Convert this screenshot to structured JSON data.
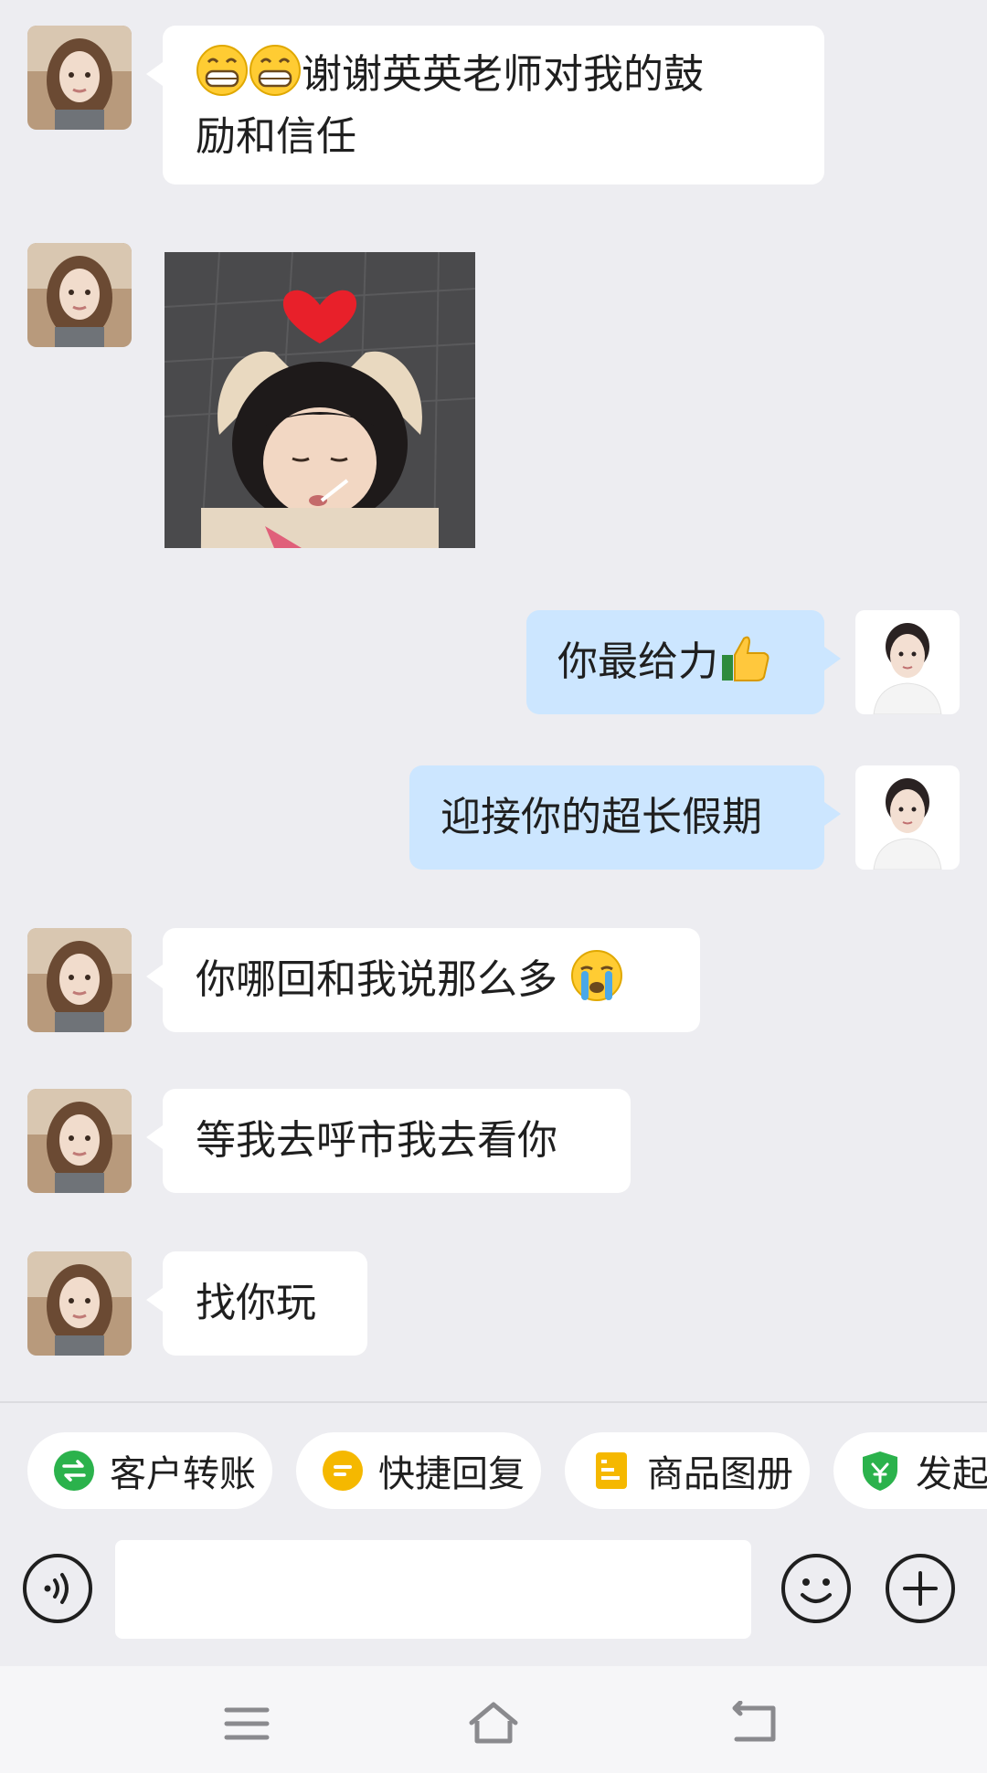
{
  "messages": [
    {
      "side": "in",
      "line1_emoji": [
        "grin-icon",
        "grin-icon"
      ],
      "line1_text": "谢谢英英老师对我的鼓",
      "line2_text": "励和信任"
    },
    {
      "side": "in",
      "type": "sticker",
      "sticker": "heart-hands-sticker"
    },
    {
      "side": "out",
      "text": "你最给力",
      "emoji": "thumbs-up-icon"
    },
    {
      "side": "out",
      "text": "迎接你的超长假期"
    },
    {
      "side": "in",
      "text": "你哪回和我说那么多",
      "emoji": "crying-face-icon"
    },
    {
      "side": "in",
      "text": "等我去呼市我去看你"
    },
    {
      "side": "in",
      "text": "找你玩"
    }
  ],
  "quick_actions": [
    {
      "label": "客户转账",
      "icon": "transfer-icon",
      "color": "#2bb24c"
    },
    {
      "label": "快捷回复",
      "icon": "quick-reply-icon",
      "color": "#f5b800"
    },
    {
      "label": "商品图册",
      "icon": "catalog-icon",
      "color": "#f5b800"
    },
    {
      "label": "发起",
      "icon": "shield-icon",
      "color": "#2bb24c"
    }
  ],
  "input": {
    "value": "",
    "placeholder": ""
  },
  "colors": {
    "background": "#ededf1",
    "incoming_bubble": "#ffffff",
    "outgoing_bubble": "#cce6ff"
  }
}
